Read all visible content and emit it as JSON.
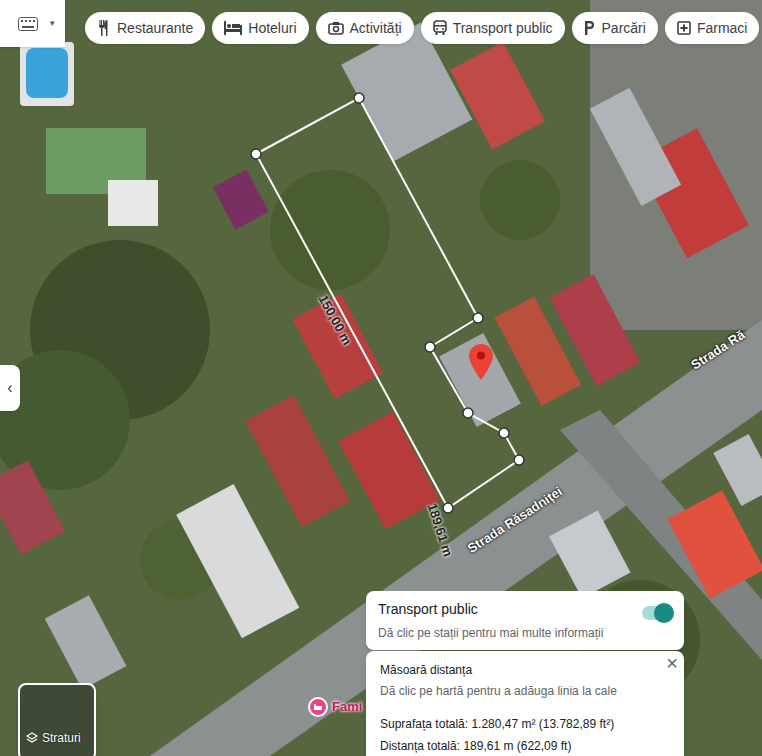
{
  "chips": [
    "Restaurante",
    "Hoteluri",
    "Activități",
    "Transport public",
    "Parcări",
    "Farmaci"
  ],
  "map_labels": {
    "street_main": "Strada Răsadniței",
    "street_right": "Strada Ră",
    "place": "Fami"
  },
  "measurement": {
    "segment_labels": [
      "150,00 m",
      "189,61 m"
    ]
  },
  "side_tab": {
    "icon": "‹"
  },
  "transport_panel": {
    "title": "Transport public",
    "subtitle": "Dă clic pe stații pentru mai multe informații",
    "toggle_on": true
  },
  "measure_panel": {
    "title": "Măsoară distanța",
    "hint": "Dă clic pe hartă pentru a adăuga linia la cale",
    "area": "Suprafața totală: 1.280,47 m² (13.782,89 ft²)",
    "distance": "Distanța totală: 189,61 m (622,09 ft)",
    "close": "×"
  },
  "layers_button": {
    "label": "Straturi"
  }
}
